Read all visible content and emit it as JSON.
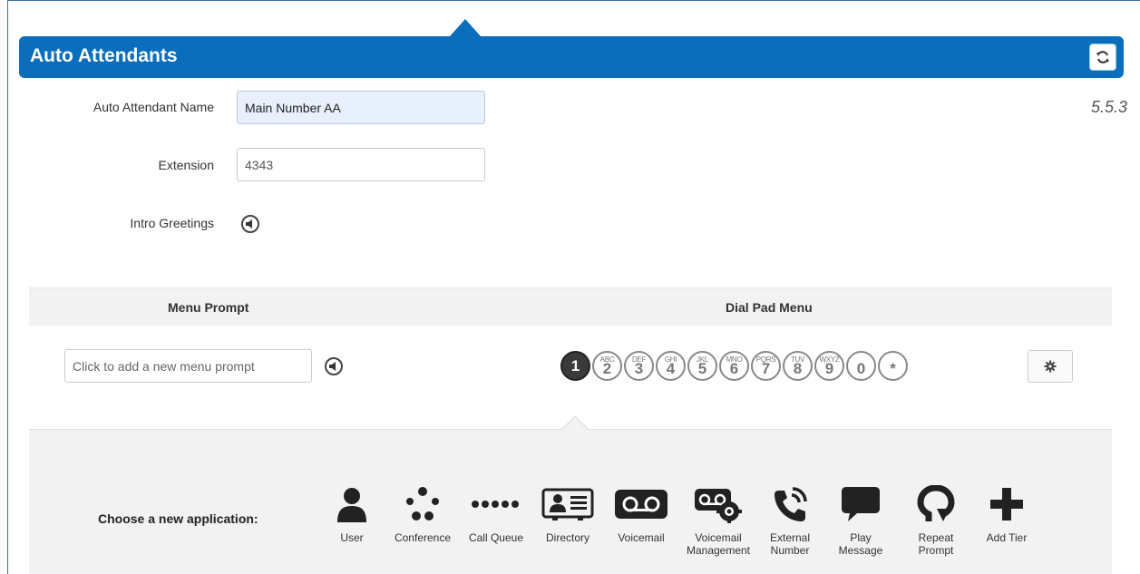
{
  "header": {
    "title": "Auto Attendants"
  },
  "version": "5.5.3",
  "form": {
    "name_label": "Auto Attendant Name",
    "name_value": "Main Number AA",
    "extension_label": "Extension",
    "extension_value": "4343",
    "greetings_label": "Intro Greetings"
  },
  "menu": {
    "prompt_header": "Menu Prompt",
    "dialpad_header": "Dial Pad Menu",
    "prompt_placeholder": "Click to add a new menu prompt"
  },
  "dialpad": [
    {
      "num": "1",
      "letters": "",
      "active": true
    },
    {
      "num": "2",
      "letters": "ABC"
    },
    {
      "num": "3",
      "letters": "DEF"
    },
    {
      "num": "4",
      "letters": "GHI"
    },
    {
      "num": "5",
      "letters": "JKL"
    },
    {
      "num": "6",
      "letters": "MNO"
    },
    {
      "num": "7",
      "letters": "PQRS"
    },
    {
      "num": "8",
      "letters": "TUV"
    },
    {
      "num": "9",
      "letters": "WXYZ"
    },
    {
      "num": "0",
      "letters": ""
    },
    {
      "num": "*",
      "letters": ""
    }
  ],
  "apps": {
    "choose_label": "Choose a new application:",
    "items": [
      {
        "label": "User",
        "icon": "user-icon"
      },
      {
        "label": "Conference",
        "icon": "conference-icon"
      },
      {
        "label": "Call Queue",
        "icon": "call-queue-icon"
      },
      {
        "label": "Directory",
        "icon": "directory-icon"
      },
      {
        "label": "Voicemail",
        "icon": "voicemail-icon"
      },
      {
        "label": "Voicemail Management",
        "icon": "voicemail-management-icon"
      },
      {
        "label": "External Number",
        "icon": "external-number-icon"
      },
      {
        "label": "Play Message",
        "icon": "play-message-icon"
      },
      {
        "label": "Repeat Prompt",
        "icon": "repeat-prompt-icon"
      },
      {
        "label": "Add Tier",
        "icon": "add-tier-icon"
      }
    ]
  },
  "colors": {
    "accent": "#0a6ebd",
    "panel": "#f2f2f2"
  }
}
